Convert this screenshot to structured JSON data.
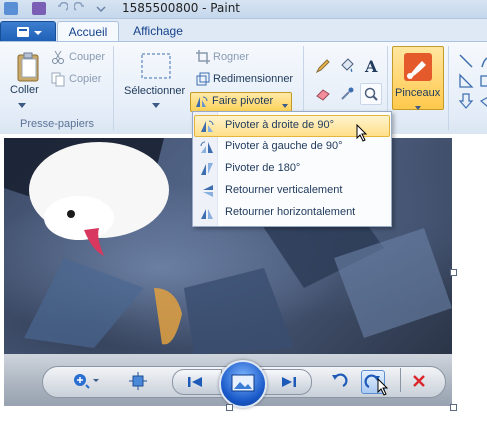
{
  "window": {
    "title": "1585500800 - Paint"
  },
  "tabs": {
    "file_label": "",
    "home": "Accueil",
    "view": "Affichage"
  },
  "clipboard": {
    "paste": "Coller",
    "cut": "Couper",
    "copy": "Copier",
    "group_label": "Presse-papiers"
  },
  "image": {
    "select": "Sélectionner",
    "crop": "Rogner",
    "resize": "Redimensionner",
    "rotate": "Faire pivoter"
  },
  "brushes": {
    "label": "Pinceaux"
  },
  "rotate_menu": {
    "items": [
      {
        "label": "Pivoter à droite de 90°",
        "highlighted": true
      },
      {
        "label": "Pivoter à gauche de 90°",
        "highlighted": false
      },
      {
        "label": "Pivoter de 180°",
        "highlighted": false
      },
      {
        "label": "Retourner verticalement",
        "highlighted": false
      },
      {
        "label": "Retourner horizontalement",
        "highlighted": false
      }
    ]
  },
  "photo_viewer_controls": [
    "zoom-icon",
    "fit-window-icon",
    "previous-icon",
    "slideshow-icon",
    "next-icon",
    "rotate-left-icon",
    "rotate-right-icon",
    "delete-icon"
  ],
  "colors": {
    "accent_highlight": "#ffd35a",
    "ribbon_bg": "#e6eef8",
    "file_button": "#1d5fb5",
    "delete_red": "#d9262b"
  }
}
